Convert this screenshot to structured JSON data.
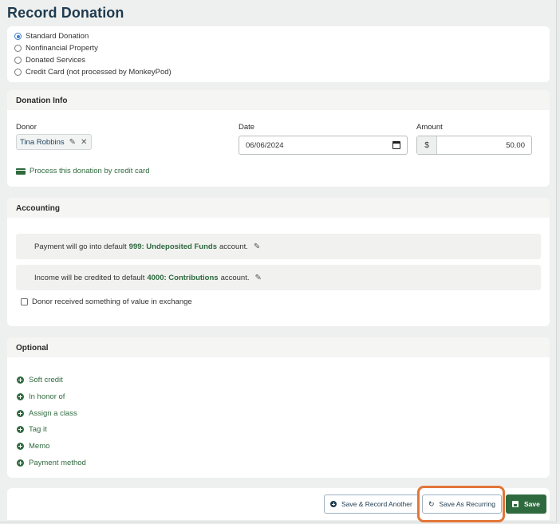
{
  "page": {
    "title": "Record Donation"
  },
  "donation_types": [
    {
      "label": "Standard Donation",
      "selected": true
    },
    {
      "label": "Nonfinancial Property",
      "selected": false
    },
    {
      "label": "Donated Services",
      "selected": false
    },
    {
      "label": "Credit Card (not processed by MonkeyPod)",
      "selected": false
    }
  ],
  "donation_info": {
    "header": "Donation Info",
    "donor_label": "Donor",
    "donor_value": "Tina Robbins",
    "date_label": "Date",
    "date_value": "06/06/2024",
    "amount_label": "Amount",
    "currency_symbol": "$",
    "amount_value": "50.00",
    "cc_link": "Process this donation by credit card"
  },
  "accounting": {
    "header": "Accounting",
    "payment_prefix": "Payment will go into default",
    "payment_account": "999: Undeposited Funds",
    "payment_suffix": "account.",
    "income_prefix": "Income will be credited to default",
    "income_account": "4000: Contributions",
    "income_suffix": "account.",
    "value_exchange_label": "Donor received something of value in exchange",
    "value_exchange_checked": false
  },
  "optional": {
    "header": "Optional",
    "items": [
      "Soft credit",
      "In honor of",
      "Assign a class",
      "Tag it",
      "Memo",
      "Payment method"
    ]
  },
  "footer": {
    "save_record_another": "Save & Record Another",
    "save_as_recurring": "Save As Recurring",
    "save": "Save"
  },
  "colors": {
    "accent_green": "#2f6a3e",
    "title_navy": "#1f3b4f",
    "highlight_orange": "#e2763a",
    "radio_blue": "#3d7cc9"
  }
}
